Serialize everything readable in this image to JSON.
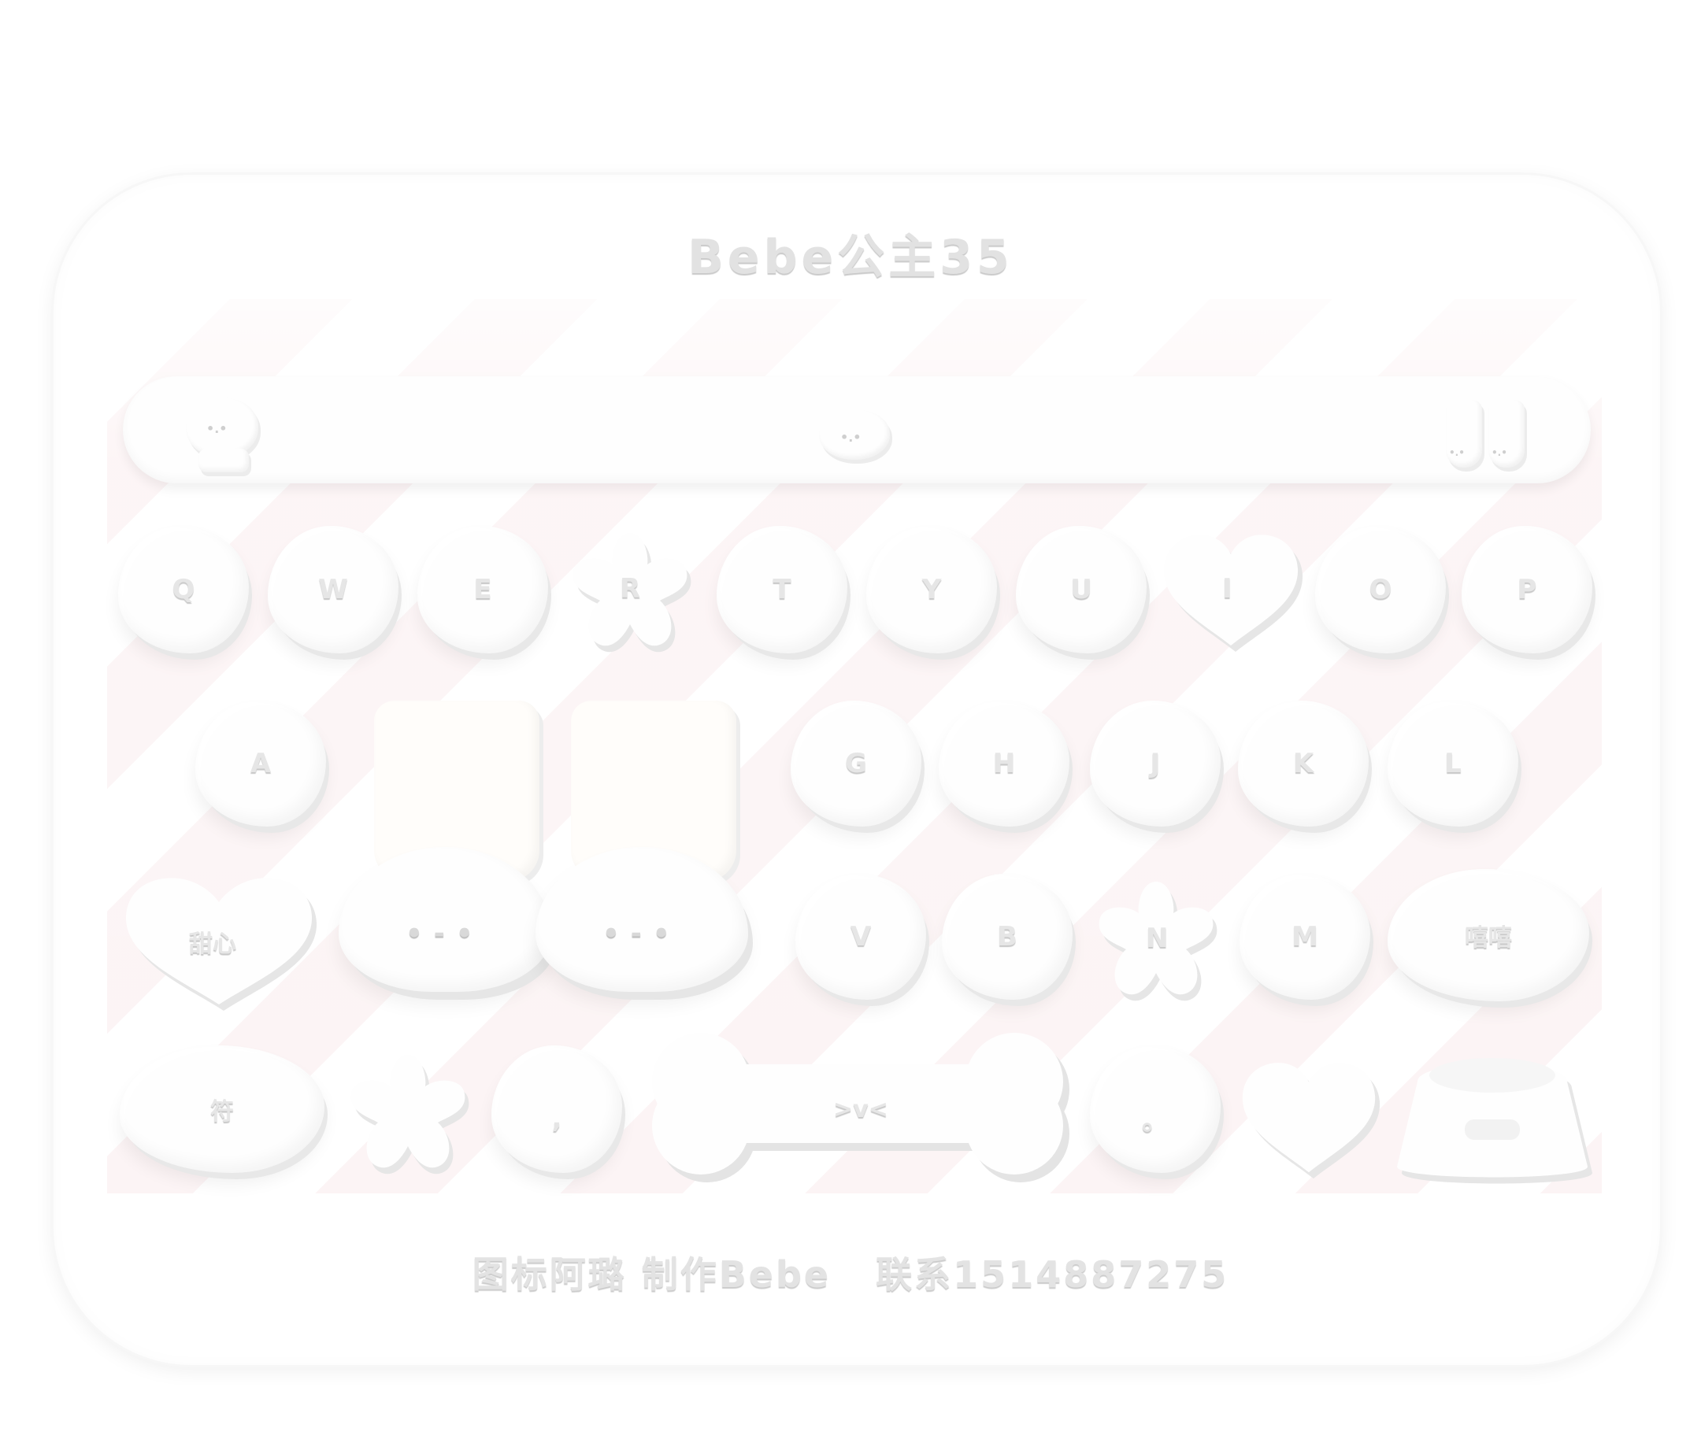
{
  "title": "Bebe公主35",
  "footer": "图标阿璐 制作Bebe   联系1514887275",
  "rows": {
    "top": [
      "Q",
      "W",
      "E",
      "R",
      "T",
      "Y",
      "U",
      "I",
      "O",
      "P"
    ],
    "middle": [
      "A",
      "G",
      "H",
      "J",
      "K",
      "L"
    ],
    "bottom": {
      "heart_left": "甜心",
      "v": "V",
      "b": "B",
      "n": "N",
      "m": "M",
      "right": "嘻嘻"
    },
    "space_row": {
      "symbols": "符",
      "comma": ",",
      "period": "。",
      "space_face": ">v<"
    }
  },
  "faces": {
    "cloud_left": "•-•",
    "cloud_right": "•-•",
    "dog_small": "•.•"
  },
  "colors": {
    "key": "#fefefe",
    "stripe": "#fcf3f4",
    "label": "#e6e6e6",
    "label_shadow": "#c7c7c7"
  }
}
